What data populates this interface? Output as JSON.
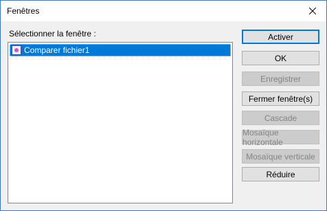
{
  "window": {
    "title": "Fenêtres"
  },
  "list": {
    "label": "Sélectionner la fenêtre :",
    "items": [
      {
        "label": "Comparer fichier1",
        "selected": true,
        "icon": "compare-document-icon"
      }
    ]
  },
  "buttons": {
    "activate": "Activer",
    "ok": "OK",
    "save": "Enregistrer",
    "close_windows": "Fermer fenêtre(s)",
    "cascade": "Cascade",
    "tile_horizontal": "Mosaïque horizontale",
    "tile_vertical": "Mosaïque verticale",
    "minimize": "Réduire"
  },
  "colors": {
    "selection": "#0078d7",
    "window_border": "#3c78c8"
  }
}
